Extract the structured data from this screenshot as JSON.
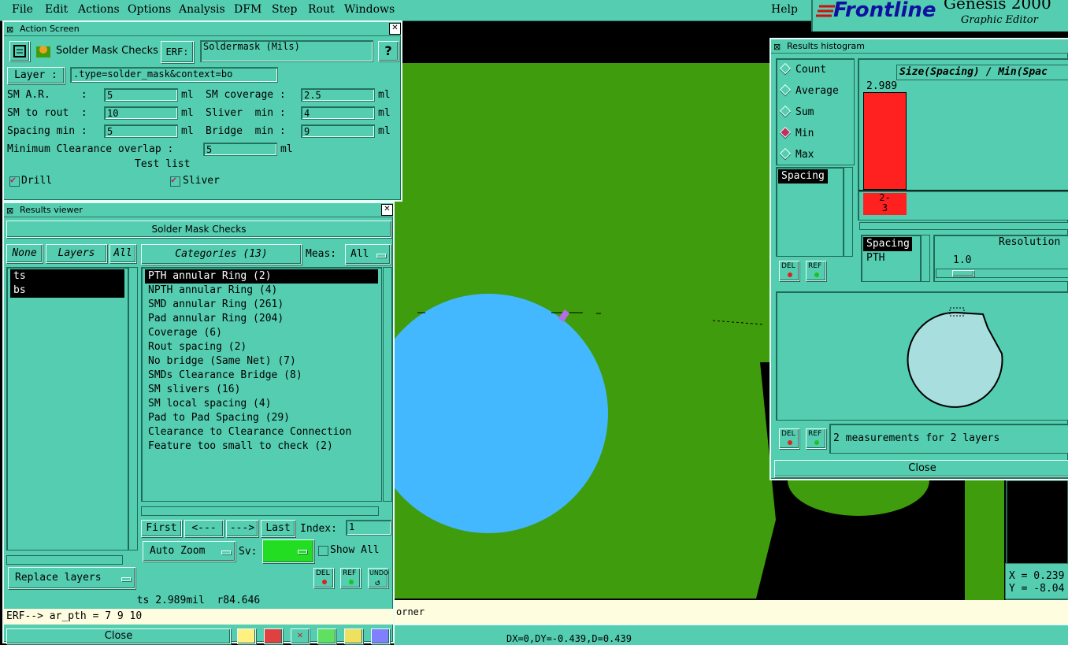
{
  "menubar": {
    "items": [
      "File",
      "Edit",
      "Actions",
      "Options",
      "Analysis",
      "DFM",
      "Step",
      "Rout",
      "Windows"
    ],
    "help": "Help"
  },
  "logo": {
    "brand": "Frontline",
    "product": "Genesis 2000",
    "subtitle": "Graphic Editor"
  },
  "action_screen": {
    "title": "Action Screen",
    "heading": "Solder Mask Checks",
    "erf_label": "ERF:",
    "erf_value": "Soldermask (Mils)",
    "help_label": "?",
    "layer_label": "Layer :",
    "layer_value": ".type=solder_mask&context=bo",
    "params": {
      "sm_ar_label": "SM A.R.     :",
      "sm_ar_value": "5",
      "sm_ar_unit": "ml",
      "sm_cov_label": "SM coverage :",
      "sm_cov_value": "2.5",
      "sm_cov_unit": "ml",
      "sm_rout_label": "SM to rout  :",
      "sm_rout_value": "10",
      "sm_rout_unit": "ml",
      "sliver_label": "Sliver  min :",
      "sliver_value": "4",
      "sliver_unit": "ml",
      "spacing_label": "Spacing min :",
      "spacing_value": "5",
      "spacing_unit": "ml",
      "bridge_label": "Bridge  min :",
      "bridge_value": "9",
      "bridge_unit": "ml",
      "clear_label": "Minimum Clearance overlap :",
      "clear_value": "5",
      "clear_unit": "ml"
    },
    "test_list_label": "Test list",
    "tests": {
      "drill": "Drill",
      "sliver": "Sliver"
    }
  },
  "results_viewer": {
    "title": "Results viewer",
    "heading": "Solder Mask Checks",
    "none_label": "None",
    "layers_label": "Layers",
    "all_label": "All",
    "layers": [
      "ts",
      "bs"
    ],
    "categories_label": "Categories (13)",
    "meas_label": "Meas:",
    "meas_value": "All",
    "categories": [
      "PTH annular Ring (2)",
      "NPTH annular Ring (4)",
      "SMD annular Ring (261)",
      "Pad annular Ring (204)",
      "Coverage (6)",
      "Rout spacing (2)",
      "No bridge (Same Net) (7)",
      "SMDs Clearance Bridge (8)",
      "SM slivers (16)",
      "SM local spacing (4)",
      "Pad to Pad Spacing (29)",
      "Clearance to Clearance Connection",
      "Feature too small to check (2)"
    ],
    "nav": {
      "first": "First",
      "prev": "<---",
      "next": "--->",
      "last": "Last",
      "index_label": "Index:",
      "index_value": "1"
    },
    "auto_zoom": "Auto Zoom",
    "sv_label": "Sv:",
    "show_all": "Show All",
    "replace_layers": "Replace layers",
    "del": "DEL",
    "ref": "REF",
    "undo": "UNDO",
    "status": "ts 2.989mil  r84.646",
    "erf_line": "ERF--> ar_pth = 7 9 10",
    "close": "Close"
  },
  "histogram": {
    "title": "Results histogram",
    "modes": [
      "Count",
      "Average",
      "Sum",
      "Min",
      "Max"
    ],
    "selected_mode": "Min",
    "chart_title": "Size(Spacing) / Min(Spac",
    "bar_value": "2.989",
    "bar_label": "2-3",
    "bar_color": "#ff2020",
    "list_item": "Spacing",
    "list2": [
      "Spacing",
      "PTH"
    ],
    "resolution_label": "Resolution",
    "resolution_value": "1.0",
    "summary": "2 measurements for 2 layers",
    "del": "DEL",
    "ref": "REF",
    "close": "Close"
  },
  "canvas": {
    "corner_text": "orner",
    "coord_x": "X = 0.239",
    "coord_y": "Y = -8.04",
    "delta": "DX=0,DY=-0.439,D=0.439"
  },
  "colors": {
    "panel": "#55cdb0",
    "board": "#3f9c0c",
    "pad": "#44b8ff",
    "accent": "#ff2020"
  }
}
